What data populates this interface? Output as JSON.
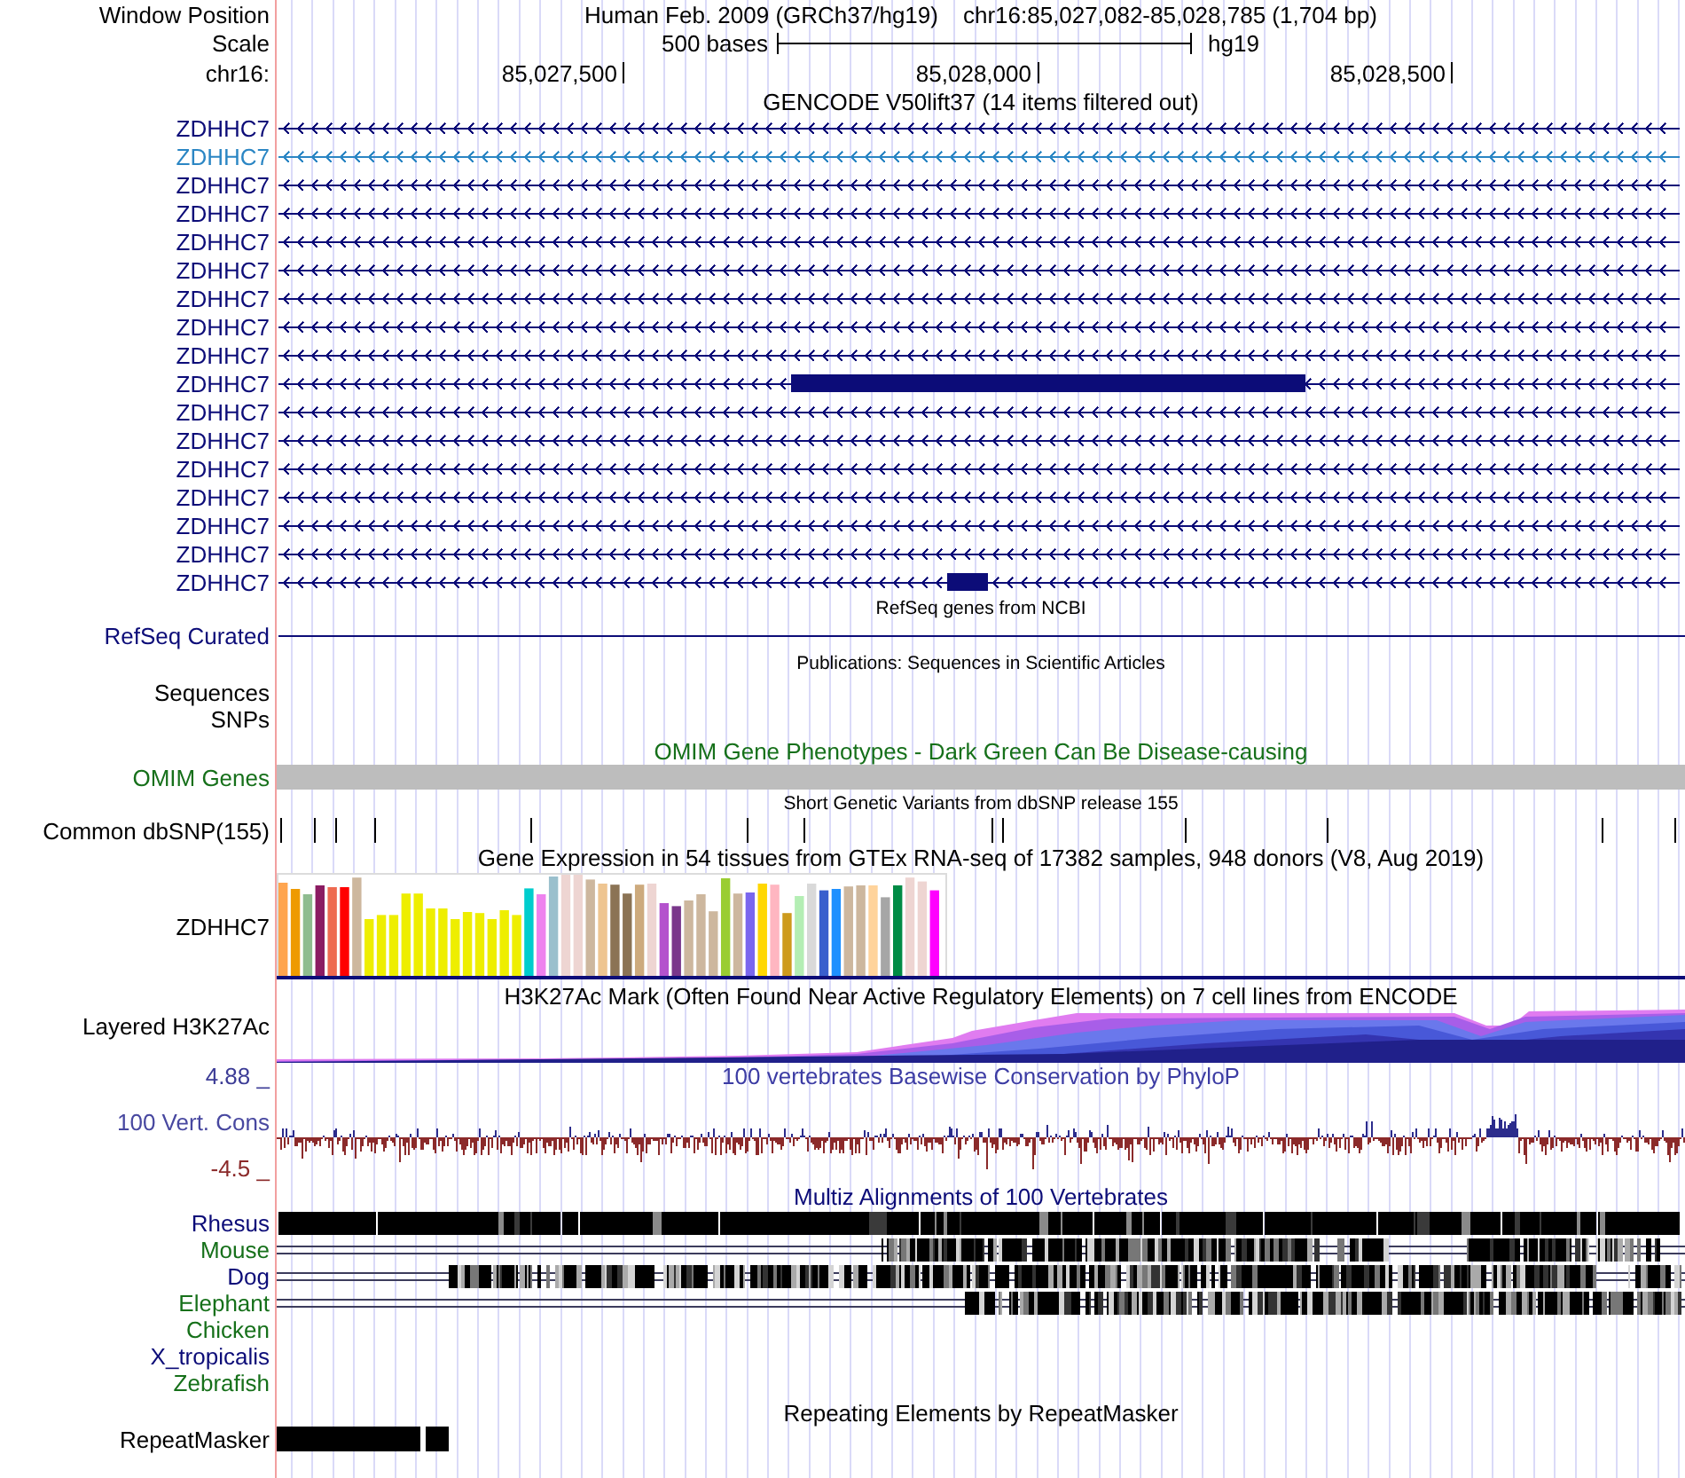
{
  "header": {
    "window_label": "Window Position",
    "assembly": "Human Feb. 2009 (GRCh37/hg19)",
    "position": "chr16:85,027,082-85,028,785 (1,704 bp)",
    "scale_label": "Scale",
    "scale_length": "500 bases",
    "scale_assembly": "hg19",
    "chrom_label": "chr16:",
    "ticks": [
      "85,027,500",
      "85,028,000",
      "85,028,500"
    ]
  },
  "gencode": {
    "title": "GENCODE V50lift37 (14 items filtered out)",
    "genes": [
      {
        "name": "ZDHHC7",
        "color": "#0c0c78",
        "kind": "plain"
      },
      {
        "name": "ZDHHC7",
        "color": "#2b86c4",
        "kind": "plain"
      },
      {
        "name": "ZDHHC7",
        "color": "#0c0c78",
        "kind": "plain"
      },
      {
        "name": "ZDHHC7",
        "color": "#0c0c78",
        "kind": "plain"
      },
      {
        "name": "ZDHHC7",
        "color": "#0c0c78",
        "kind": "plain"
      },
      {
        "name": "ZDHHC7",
        "color": "#0c0c78",
        "kind": "plain"
      },
      {
        "name": "ZDHHC7",
        "color": "#0c0c78",
        "kind": "plain"
      },
      {
        "name": "ZDHHC7",
        "color": "#0c0c78",
        "kind": "plain"
      },
      {
        "name": "ZDHHC7",
        "color": "#0c0c78",
        "kind": "plain"
      },
      {
        "name": "ZDHHC7",
        "color": "#0c0c78",
        "kind": "long"
      },
      {
        "name": "ZDHHC7",
        "color": "#0c0c78",
        "kind": "plain"
      },
      {
        "name": "ZDHHC7",
        "color": "#0c0c78",
        "kind": "plain"
      },
      {
        "name": "ZDHHC7",
        "color": "#0c0c78",
        "kind": "plain"
      },
      {
        "name": "ZDHHC7",
        "color": "#0c0c78",
        "kind": "plain"
      },
      {
        "name": "ZDHHC7",
        "color": "#0c0c78",
        "kind": "plain"
      },
      {
        "name": "ZDHHC7",
        "color": "#0c0c78",
        "kind": "plain"
      },
      {
        "name": "ZDHHC7",
        "color": "#0c0c78",
        "kind": "short"
      }
    ]
  },
  "refseq": {
    "title": "RefSeq genes from NCBI",
    "label": "RefSeq Curated"
  },
  "publications": {
    "title": "Publications: Sequences in Scientific Articles",
    "labels": [
      "Sequences",
      "SNPs"
    ]
  },
  "omim": {
    "title": "OMIM Gene Phenotypes - Dark Green Can Be Disease-causing",
    "label": "OMIM Genes"
  },
  "dbsnp": {
    "title": "Short Genetic Variants from dbSNP release 155",
    "label": "Common dbSNP(155)"
  },
  "gtex": {
    "title": "Gene Expression in 54 tissues from GTEx RNA-seq of 17382 samples, 948 donors (V8, Aug 2019)",
    "label": "ZDHHC7"
  },
  "h3k27ac": {
    "title": "H3K27Ac Mark (Often Found Near Active Regulatory Elements) on 7 cell lines from ENCODE",
    "label": "Layered H3K27Ac"
  },
  "conservation": {
    "title": "100 vertebrates Basewise Conservation by PhyloP",
    "max_label": "4.88 _",
    "label": "100 Vert. Cons",
    "min_label": "-4.5 _"
  },
  "multiz": {
    "title": "Multiz Alignments of 100 Vertebrates",
    "species": [
      {
        "name": "Rhesus",
        "color": "#0c0c78",
        "kind": "aligned"
      },
      {
        "name": "Mouse",
        "color": "#16701a",
        "kind": "aligned"
      },
      {
        "name": "Dog",
        "color": "#0c0c78",
        "kind": "aligned"
      },
      {
        "name": "Elephant",
        "color": "#16701a",
        "kind": "aligned"
      },
      {
        "name": "Chicken",
        "color": "#16701a",
        "kind": "none"
      },
      {
        "name": "X_tropicalis",
        "color": "#0c0c78",
        "kind": "none"
      },
      {
        "name": "Zebrafish",
        "color": "#16701a",
        "kind": "none"
      }
    ]
  },
  "repeatmasker": {
    "title": "Repeating Elements by RepeatMasker",
    "label": "RepeatMasker"
  }
}
